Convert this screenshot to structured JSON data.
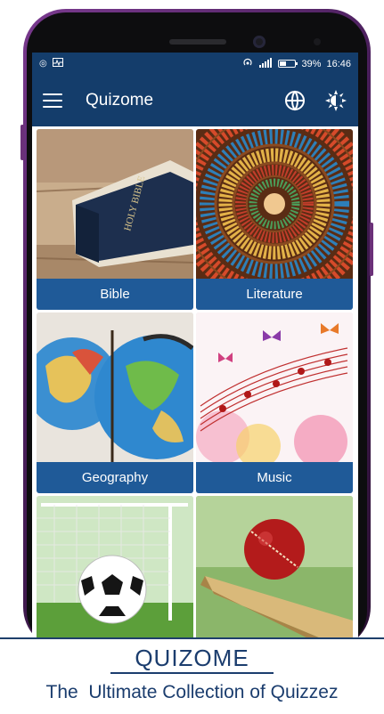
{
  "status_bar": {
    "battery": "39%",
    "time": "16:46",
    "battery_level": 0.39,
    "icons": [
      "circle-notification-icon",
      "activity-icon",
      "hotspot-icon",
      "signal-icon"
    ]
  },
  "app_bar": {
    "title": "Quizome",
    "menu_icon": "hamburger-menu-icon",
    "language_icon": "globe-icon",
    "theme_icon": "brightness-icon"
  },
  "categories": [
    {
      "label": "Bible",
      "image": "bible-book"
    },
    {
      "label": "Literature",
      "image": "spiral-bookshelf"
    },
    {
      "label": "Geography",
      "image": "globes"
    },
    {
      "label": "Music",
      "image": "music-notes-butterflies"
    },
    {
      "label": "",
      "image": "football-goal"
    },
    {
      "label": "",
      "image": "cricket-ball-bat"
    }
  ],
  "banner": {
    "title": "QUIZOME",
    "subtitle": "The  Ultimate Collection of Quizzez"
  },
  "colors": {
    "primary": "#143d6b",
    "tile_label": "#1f5a98",
    "phone": "#5e2a70",
    "banner_text": "#1b3d6e"
  }
}
